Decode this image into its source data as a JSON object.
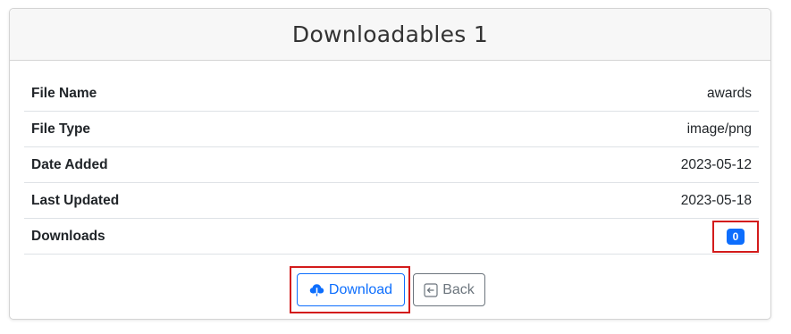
{
  "header": {
    "title": "Downloadables 1"
  },
  "details": [
    {
      "label": "File Name",
      "value": "awards"
    },
    {
      "label": "File Type",
      "value": "image/png"
    },
    {
      "label": "Date Added",
      "value": "2023-05-12"
    },
    {
      "label": "Last Updated",
      "value": "2023-05-18"
    }
  ],
  "downloads": {
    "label": "Downloads",
    "count": "0"
  },
  "actions": {
    "download_label": "Download",
    "back_label": "Back"
  },
  "colors": {
    "primary": "#0d6efd",
    "secondary": "#6c757d",
    "highlight": "#d31b1b"
  },
  "icons": {
    "download": "cloud-download-icon",
    "back": "box-arrow-left-icon"
  }
}
